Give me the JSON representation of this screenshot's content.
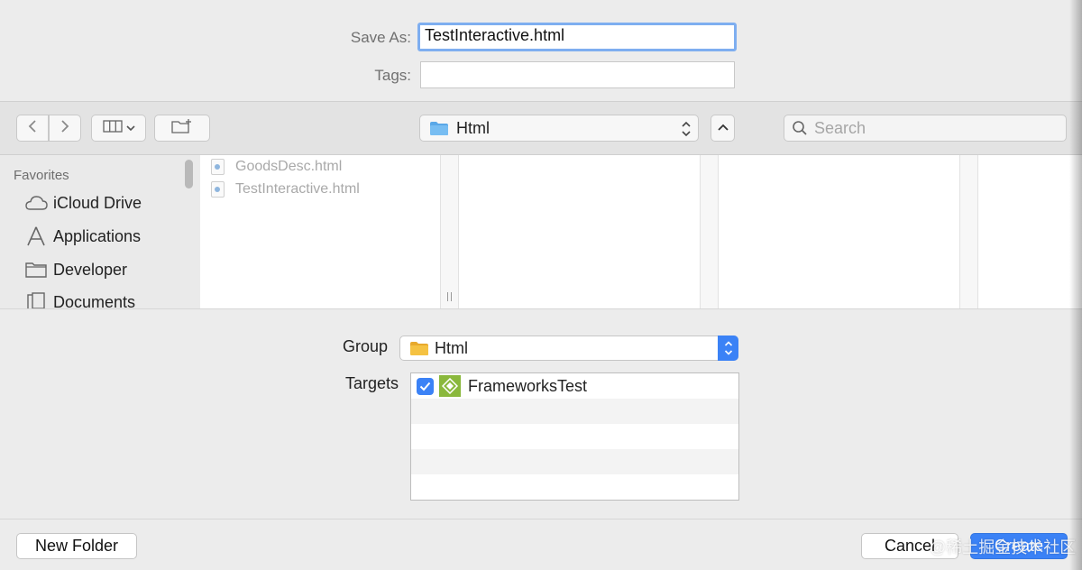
{
  "save": {
    "save_as_label": "Save As:",
    "save_as_value": "TestInteractive.html",
    "tags_label": "Tags:",
    "tags_value": ""
  },
  "toolbar": {
    "back_icon": "chevron-left-icon",
    "forward_icon": "chevron-right-icon",
    "view_icon": "column-view-icon",
    "new_folder_icon": "new-folder-icon",
    "location_label": "Html",
    "search_placeholder": "Search"
  },
  "sidebar": {
    "section_label": "Favorites",
    "items": [
      {
        "label": "iCloud Drive",
        "icon": "cloud-icon"
      },
      {
        "label": "Applications",
        "icon": "applications-icon"
      },
      {
        "label": "Developer",
        "icon": "folder-icon"
      },
      {
        "label": "Documents",
        "icon": "documents-icon"
      }
    ]
  },
  "files": [
    {
      "name": "GoodsDesc.html"
    },
    {
      "name": "TestInteractive.html"
    }
  ],
  "options": {
    "group_label": "Group",
    "group_value": "Html",
    "targets_label": "Targets",
    "targets": [
      {
        "name": "FrameworksTest",
        "checked": true
      }
    ]
  },
  "footer": {
    "new_folder_button": "New Folder",
    "cancel_button": "Cancel",
    "create_button": "Create",
    "watermark": "@稀土掘金技术社区"
  },
  "colors": {
    "accent": "#3b82f6",
    "focus_ring": "#7eaef0",
    "folder": "#5aa8e8",
    "group_folder": "#f5c242",
    "target_icon": "#8ab83c"
  }
}
